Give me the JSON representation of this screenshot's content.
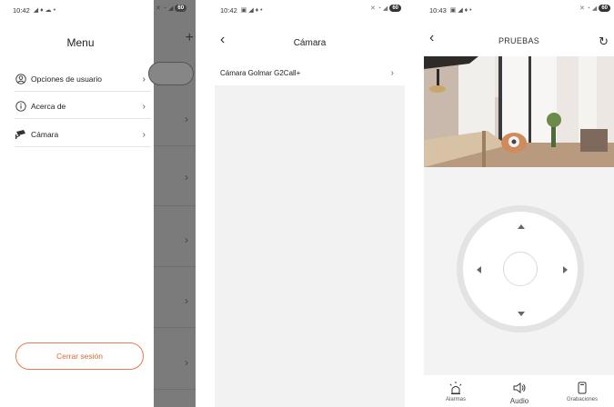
{
  "screen1": {
    "status_time": "10:42",
    "menu_title": "Menu",
    "items": [
      {
        "label": "Opciones de usuario",
        "icon": "user-circle-icon"
      },
      {
        "label": "Acerca de",
        "icon": "info-icon"
      },
      {
        "label": "Cámara",
        "icon": "security-camera-icon"
      }
    ],
    "logout_label": "Cerrar sesión",
    "accent_color": "#e06832"
  },
  "screen2": {
    "status_time": "10:42",
    "title": "Cámara",
    "row_label": "Cámara Golmar G2Call+"
  },
  "screen3": {
    "status_time": "10:43",
    "title": "PRUEBAS",
    "tabs": [
      {
        "label": "Alarmas",
        "icon": "alarm-light-icon"
      },
      {
        "label": "Audio",
        "icon": "speaker-icon"
      },
      {
        "label": "Grabaciones",
        "icon": "phone-icon"
      }
    ]
  },
  "battery": "60"
}
